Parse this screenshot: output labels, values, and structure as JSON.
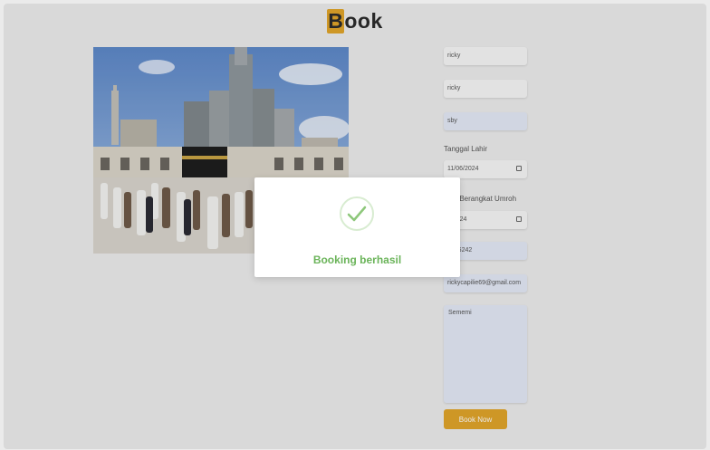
{
  "header": {
    "title_initial": "B",
    "title_rest": "ook"
  },
  "form": {
    "first_name_value": "ricky",
    "last_name_value": "ricky",
    "city_value": "sby",
    "birth_date_label": "Tanggal Lahir",
    "birth_date_value": "11/06/2024",
    "departure_label": "ggal Berangkat Umroh",
    "departure_value": "6/2024",
    "phone_value": "1596242",
    "email_value": "rickycapilie69@gmail.com",
    "address_value": "Sememi",
    "submit_label": "Book Now"
  },
  "dialog": {
    "message": "Booking berhasil"
  },
  "colors": {
    "accent": "#e0a42a",
    "success": "#6bb45a"
  }
}
